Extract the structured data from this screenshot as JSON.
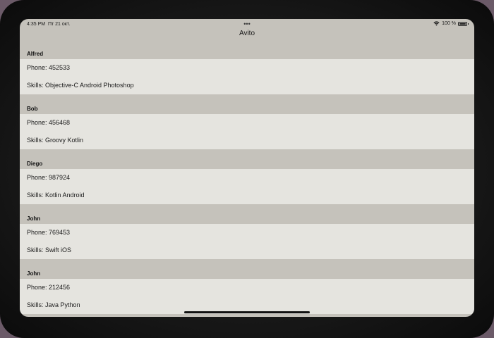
{
  "status_bar": {
    "time": "4:35 PM",
    "date": "Пт 21 окт.",
    "multitask_dots": "•••",
    "battery_percent": "100 %",
    "icons": [
      "wifi-icon",
      "battery-icon"
    ]
  },
  "navbar": {
    "title": "Avito"
  },
  "employees": [
    {
      "name": "Alfred",
      "phone": "Phone: 452533",
      "skills": "Skills: Objective-C Android Photoshop"
    },
    {
      "name": "Bob",
      "phone": "Phone: 456468",
      "skills": "Skills: Groovy Kotlin"
    },
    {
      "name": "Diego",
      "phone": "Phone: 987924",
      "skills": "Skills: Kotlin Android"
    },
    {
      "name": "John",
      "phone": "Phone: 769453",
      "skills": "Skills: Swift iOS"
    },
    {
      "name": "John",
      "phone": "Phone: 212456",
      "skills": "Skills: Java Python"
    }
  ],
  "colors": {
    "device_bezel": "#151515",
    "section_header_bg": "#c5c2bb",
    "cell_bg": "#e5e4df",
    "text": "#1a1a1a"
  }
}
